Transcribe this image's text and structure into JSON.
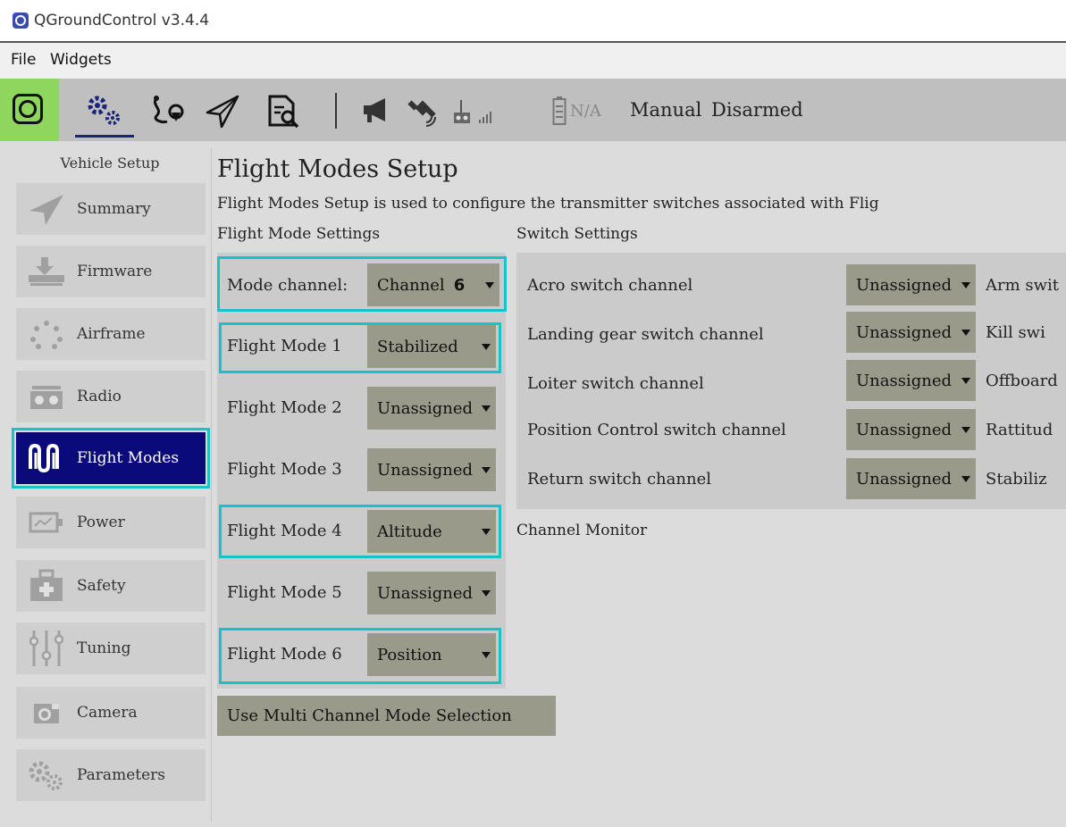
{
  "window": {
    "title": "QGroundControl v3.4.4"
  },
  "menu": {
    "file": "File",
    "widgets": "Widgets"
  },
  "toolbar": {
    "battery": "N/A",
    "flight_mode": "Manual",
    "arm_state": "Disarmed",
    "icons": [
      "qgc-logo-icon",
      "vehicle-setup-icon",
      "plan-icon",
      "fly-icon",
      "analyze-icon",
      "messages-icon",
      "gps-icon",
      "rc-rssi-icon",
      "battery-icon"
    ]
  },
  "sidebar": {
    "title": "Vehicle Setup",
    "items": [
      {
        "label": "Summary",
        "icon": "summary-icon"
      },
      {
        "label": "Firmware",
        "icon": "firmware-icon"
      },
      {
        "label": "Airframe",
        "icon": "airframe-icon"
      },
      {
        "label": "Radio",
        "icon": "radio-icon"
      },
      {
        "label": "Flight Modes",
        "icon": "flight-modes-icon"
      },
      {
        "label": "Power",
        "icon": "power-icon"
      },
      {
        "label": "Safety",
        "icon": "safety-icon"
      },
      {
        "label": "Tuning",
        "icon": "tuning-icon"
      },
      {
        "label": "Camera",
        "icon": "camera-icon"
      },
      {
        "label": "Parameters",
        "icon": "parameters-icon"
      }
    ],
    "active": "Flight Modes"
  },
  "page": {
    "title": "Flight Modes Setup",
    "description": "Flight Modes Setup is used to configure the transmitter switches associated with Flig",
    "flight_mode_settings_title": "Flight Mode Settings",
    "switch_settings_title": "Switch Settings",
    "channel_monitor_title": "Channel Monitor"
  },
  "flight_mode_settings": {
    "mode_channel_label": "Mode channel:",
    "mode_channel_prefix": "Channel",
    "mode_channel_number": "6",
    "modes": [
      {
        "label": "Flight Mode 1",
        "value": "Stabilized"
      },
      {
        "label": "Flight Mode 2",
        "value": "Unassigned"
      },
      {
        "label": "Flight Mode 3",
        "value": "Unassigned"
      },
      {
        "label": "Flight Mode 4",
        "value": "Altitude"
      },
      {
        "label": "Flight Mode 5",
        "value": "Unassigned"
      },
      {
        "label": "Flight Mode 6",
        "value": "Position"
      }
    ],
    "multi_channel_button": "Use Multi Channel Mode Selection"
  },
  "switch_settings": {
    "rows": [
      {
        "label": "Acro switch channel",
        "value": "Unassigned",
        "right_label": "Arm swit"
      },
      {
        "label": "Landing gear switch channel",
        "value": "Unassigned",
        "right_label": "Kill swi"
      },
      {
        "label": "Loiter switch channel",
        "value": "Unassigned",
        "right_label": "Offboard"
      },
      {
        "label": "Position Control switch channel",
        "value": "Unassigned",
        "right_label": "Rattitud"
      },
      {
        "label": "Return switch channel",
        "value": "Unassigned",
        "right_label": "Stabiliz"
      }
    ]
  },
  "colors": {
    "highlight": "#17c2c9",
    "active_nav": "#0a0a7a",
    "combo": "#9a9a8a",
    "logo_bg": "#8fd65f"
  }
}
